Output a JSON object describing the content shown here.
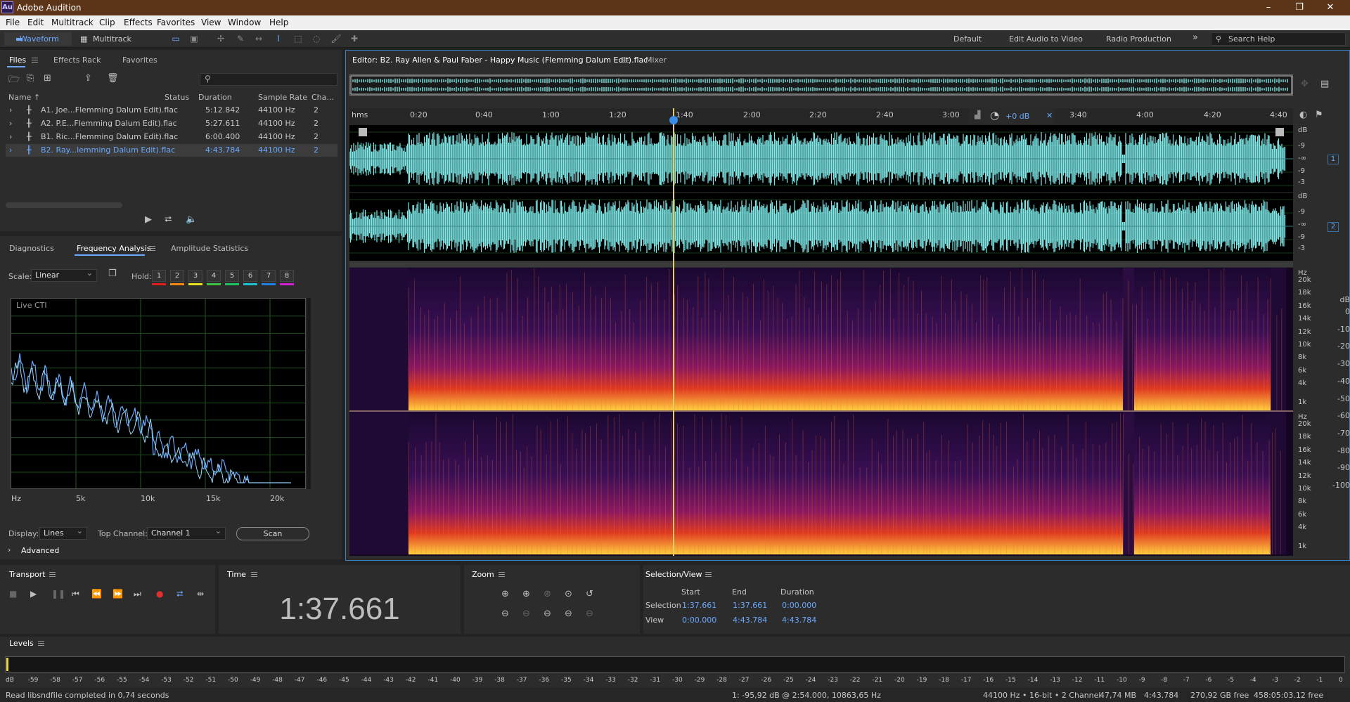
{
  "app": {
    "title": "Adobe Audition",
    "logo": "Au"
  },
  "menu": [
    "File",
    "Edit",
    "Multitrack",
    "Clip",
    "Effects",
    "Favorites",
    "View",
    "Window",
    "Help"
  ],
  "toolbar": {
    "waveform": "Waveform",
    "multitrack": "Multitrack",
    "workspaces": [
      "Default",
      "Edit Audio to Video",
      "Radio Production"
    ],
    "more": "»",
    "search_placeholder": "Search Help"
  },
  "files_panel": {
    "tabs": [
      "Files",
      "Effects Rack",
      "Favorites"
    ],
    "columns": [
      "Name",
      "Status",
      "Duration",
      "Sample Rate",
      "Cha..."
    ],
    "rows": [
      {
        "name": "A1. Joe...Flemming Dalum Edit).flac",
        "duration": "5:12.842",
        "rate": "44100 Hz",
        "ch": "2"
      },
      {
        "name": "A2. P.E...Flemming Dalum Edit).flac",
        "duration": "5:27.611",
        "rate": "44100 Hz",
        "ch": "2"
      },
      {
        "name": "B1. Ric...Flemming Dalum Edit).flac",
        "duration": "6:00.400",
        "rate": "44100 Hz",
        "ch": "2"
      },
      {
        "name": "B2. Ray...lemming Dalum Edit).flac",
        "duration": "4:43.784",
        "rate": "44100 Hz",
        "ch": "2"
      }
    ]
  },
  "analysis": {
    "tabs": [
      "Diagnostics",
      "Frequency Analysis",
      "Amplitude Statistics"
    ],
    "scale_label": "Scale:",
    "scale_value": "Linear",
    "hold_label": "Hold:",
    "hold_buttons": [
      "1",
      "2",
      "3",
      "4",
      "5",
      "6",
      "7",
      "8"
    ],
    "hold_colors": [
      "#e02020",
      "#f08a10",
      "#e8e020",
      "#40c040",
      "#20c060",
      "#20c0d0",
      "#2080e0",
      "#d020d0"
    ],
    "graph_label": "Live CTI",
    "db_unit": "dB",
    "db_ticks": [
      "0",
      "-10",
      "-20",
      "-30",
      "-40",
      "-50",
      "-60",
      "-70",
      "-80",
      "-90",
      "-100"
    ],
    "hz_ticks": [
      "Hz",
      "5k",
      "10k",
      "15k",
      "20k"
    ],
    "display_label": "Display:",
    "display_value": "Lines",
    "top_channel_label": "Top Channel:",
    "top_channel_value": "Channel 1",
    "scan": "Scan",
    "advanced": "Advanced"
  },
  "editor": {
    "tab": "Editor: B2. Ray Allen & Paul Faber - Happy Music (Flemming Dalum Edit).flac",
    "mixer": "Mixer",
    "ruler": [
      "hms",
      "0:20",
      "0:40",
      "1:00",
      "1:20",
      "1:40",
      "2:00",
      "2:20",
      "2:40",
      "3:00",
      "3:40",
      "4:00",
      "4:20",
      "4:40"
    ],
    "gain": "+0 dB",
    "db_labels": [
      "dB",
      "-9",
      "-∞",
      "-9",
      "-3"
    ],
    "channels": [
      "1",
      "2"
    ],
    "hz_labels": [
      "Hz",
      "20k",
      "18k",
      "16k",
      "14k",
      "12k",
      "10k",
      "8k",
      "6k",
      "4k",
      "1k"
    ]
  },
  "transport": {
    "title": "Transport"
  },
  "time": {
    "title": "Time",
    "value": "1:37.661"
  },
  "zoom": {
    "title": "Zoom"
  },
  "selection": {
    "title": "Selection/View",
    "headers": [
      "Start",
      "End",
      "Duration"
    ],
    "rows": [
      {
        "label": "Selection",
        "start": "1:37.661",
        "end": "1:37.661",
        "duration": "0:00.000"
      },
      {
        "label": "View",
        "start": "0:00.000",
        "end": "4:43.784",
        "duration": "4:43.784"
      }
    ]
  },
  "levels": {
    "title": "Levels",
    "ticks": [
      "dB",
      "-59",
      "-58",
      "-57",
      "-56",
      "-55",
      "-54",
      "-53",
      "-52",
      "-51",
      "-50",
      "-49",
      "-48",
      "-47",
      "-46",
      "-45",
      "-44",
      "-43",
      "-42",
      "-41",
      "-40",
      "-39",
      "-38",
      "-37",
      "-36",
      "-35",
      "-34",
      "-33",
      "-32",
      "-31",
      "-30",
      "-29",
      "-28",
      "-27",
      "-26",
      "-25",
      "-24",
      "-23",
      "-22",
      "-21",
      "-20",
      "-19",
      "-18",
      "-17",
      "-16",
      "-15",
      "-14",
      "-13",
      "-12",
      "-11",
      "-10",
      "-9",
      "-8",
      "-7",
      "-6",
      "-5",
      "-4",
      "-3",
      "-2",
      "-1",
      "0"
    ]
  },
  "status": {
    "left": "Read libsndfile completed in 0,74 seconds",
    "info": "1: -95,92 dB @ 2:54.000, 10863,65 Hz",
    "format": "44100 Hz • 16-bit • 2 Channel",
    "size": "47,74 MB",
    "duration": "4:43.784",
    "free": "270,92 GB free",
    "free_time": "458:05:03.12 free"
  },
  "colors": {
    "accent": "#6aa9ff",
    "waveform": "#7fe8e8",
    "titlebar": "#5c3418",
    "playhead": "#e8d060"
  }
}
